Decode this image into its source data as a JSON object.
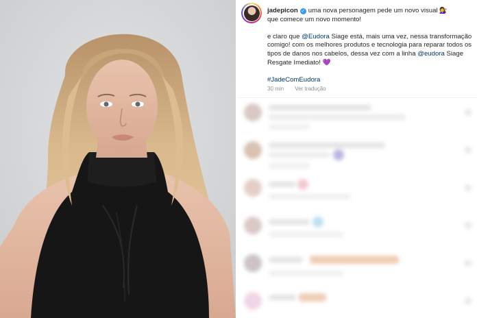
{
  "post": {
    "username": "jadepicon",
    "caption_line1": "uma nova personagem pede um novo visual",
    "caption_emoji": "💇‍♀️",
    "caption_line2": "que comece um novo momento!",
    "para2_a": "e claro que ",
    "para2_mention1": "@Eudora",
    "para2_b": " Siage está, mais uma vez, nessa transformação comigo! com os melhores produtos e tecnologia para reparar todos os tipos de danos nos cabelos, dessa vez com a linha ",
    "para2_mention2": "@eudora",
    "para2_c": " Siage Resgate Imediato!",
    "para2_heart": "💜",
    "hashtag": "#JadeComEudora",
    "time": "30 min",
    "translate": "Ver tradução"
  },
  "comments_blurred": {
    "colors": {
      "avatar": [
        "#d8c8c6",
        "#d9c2b0",
        "#e3cfc8",
        "#d9c9c7",
        "#cbc3c7",
        "#f0d6e6"
      ],
      "accent_purple": "#b9b7e2",
      "accent_peach": "#f0cdb6",
      "accent_blue": "#bfe0f0",
      "accent_pink": "#f2c9d0"
    }
  }
}
